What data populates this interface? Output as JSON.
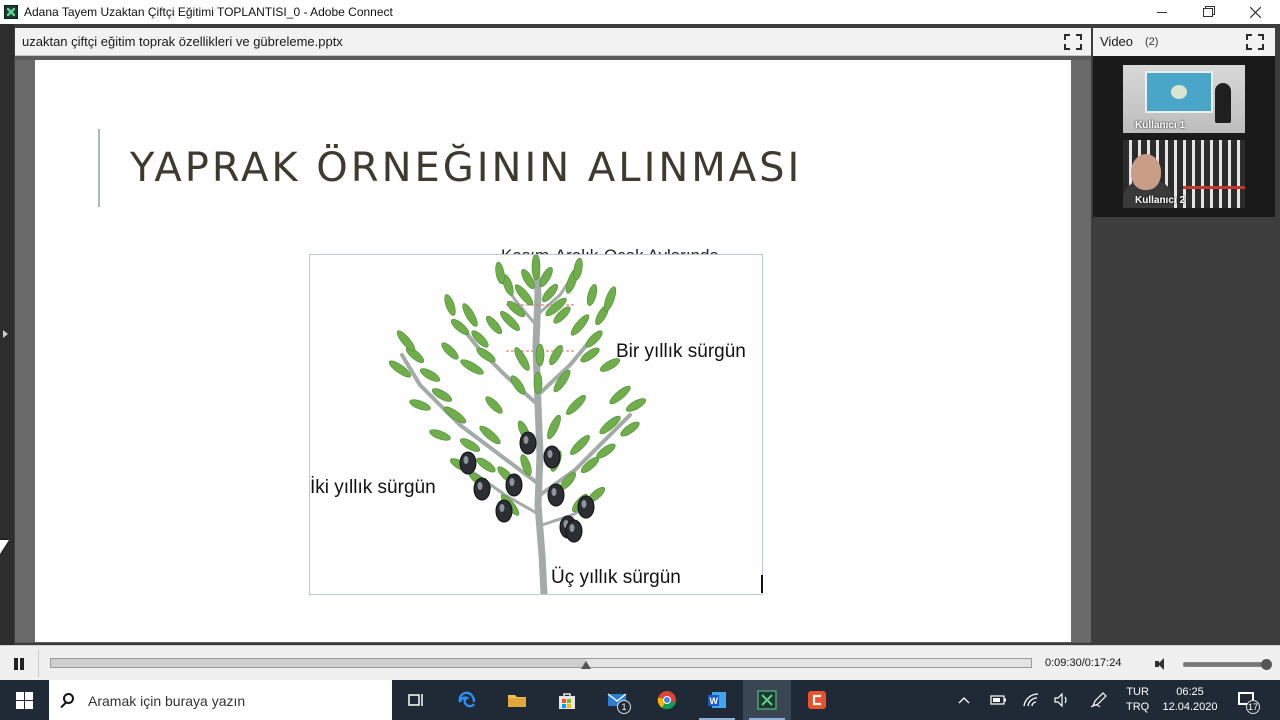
{
  "window": {
    "title": "Adana Tayem Uzaktan Çiftçi Eğitimi TOPLANTISI_0 - Adobe Connect",
    "app_icon": "adobe-connect-icon",
    "controls": [
      "minimize-icon",
      "restore-icon",
      "close-icon"
    ]
  },
  "share_pod": {
    "title": "uzaktan çiftçi eğitim toprak özellikleri ve gübreleme.pptx",
    "expand_icon": "fullscreen-icon"
  },
  "slide": {
    "title": "YAPRAK ÖRNEĞININ ALINMASI",
    "subtitle": "Kasım-Aralık-Ocak Aylarında",
    "diagram": {
      "label_one_year": "Bir yıllık sürgün",
      "label_two_year": "İki yıllık sürgün",
      "label_three_year": "Üç yıllık sürgün"
    }
  },
  "video_pod": {
    "title": "Video",
    "count": "(2)",
    "participants": [
      {
        "name": "Kullanıcı 1"
      },
      {
        "name": "Kullanıcı 2"
      }
    ]
  },
  "playback": {
    "time": "0:09:30/0:17:24",
    "progress": 0.546,
    "volume": 1.0
  },
  "taskbar": {
    "search_placeholder": "Aramak için buraya yazın",
    "mail_badge": "1",
    "language": "TUR",
    "language_sub": "TRQ",
    "time": "06:25",
    "date": "12.04.2020",
    "notification_count": "17"
  },
  "colors": {
    "leaf_green": "#6fae4b",
    "branch": "#9aa3a0",
    "olive": "#2b2e33",
    "title_text": "#3e3a2f",
    "taskbar": "#1f2a36"
  }
}
